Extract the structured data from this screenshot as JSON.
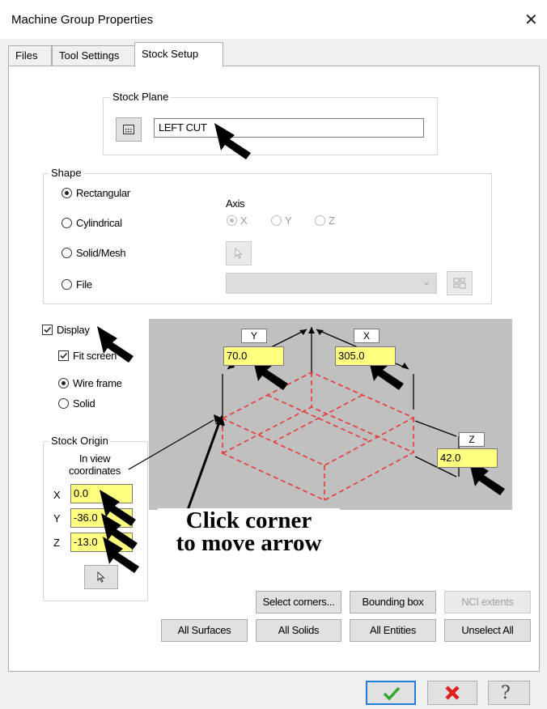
{
  "window": {
    "title": "Machine Group Properties"
  },
  "tabs": [
    "Files",
    "Tool Settings",
    "Stock Setup"
  ],
  "stock_plane": {
    "label": "Stock Plane",
    "value": "LEFT CUT"
  },
  "shape": {
    "label": "Shape",
    "options": [
      "Rectangular",
      "Cylindrical",
      "Solid/Mesh",
      "File"
    ],
    "selected": "Rectangular",
    "axis_label": "Axis",
    "axis_options": [
      "X",
      "Y",
      "Z"
    ],
    "axis_selected": "X"
  },
  "display": {
    "label": "Display",
    "checked": true
  },
  "fit_screen": {
    "label": "Fit screen",
    "checked": true
  },
  "render_modes": [
    "Wire frame",
    "Solid"
  ],
  "render_selected": "Wire frame",
  "stock_origin": {
    "label": "Stock Origin",
    "subtitle_line1": "In view",
    "subtitle_line2": "coordinates",
    "x_label": "X",
    "x_value": "0.0",
    "y_label": "Y",
    "y_value": "-36.0",
    "z_label": "Z",
    "z_value": "-13.0"
  },
  "preview": {
    "y_label": "Y",
    "y_value": "70.0",
    "x_label": "X",
    "x_value": "305.0",
    "z_label": "Z",
    "z_value": "42.0",
    "wire_color": "#e8383a"
  },
  "annotation": {
    "line1": "Click corner",
    "line2": "to move arrow"
  },
  "buttons": {
    "select_corners": "Select corners...",
    "bounding_box": "Bounding box",
    "nci_extents": "NCI extents",
    "all_surfaces": "All Surfaces",
    "all_solids": "All Solids",
    "all_entities": "All Entities",
    "unselect_all": "Unselect All"
  },
  "footer": {
    "ok_icon": "checkmark-icon",
    "cancel_icon": "red-x-icon",
    "help_icon": "question-icon",
    "ok_color": "#2eaa2e",
    "cancel_color": "#e02020"
  }
}
